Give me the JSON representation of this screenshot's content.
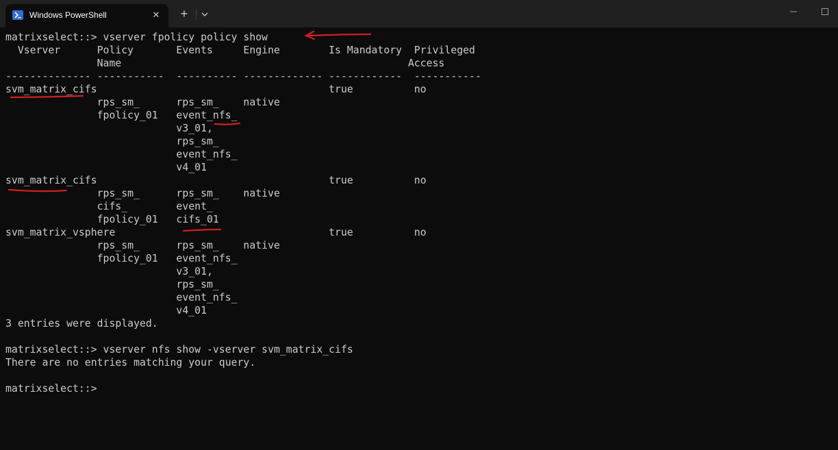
{
  "window": {
    "tab_title": "Windows PowerShell",
    "tab_icon": "powershell-icon",
    "close_tab_icon": "close-icon",
    "new_tab_icon": "plus-icon",
    "dropdown_icon": "chevron-down-icon",
    "minimize_icon": "minimize-icon",
    "maximize_icon": "maximize-icon"
  },
  "terminal": {
    "lines": [
      "matrixselect::> vserver fpolicy policy show",
      "  Vserver      Policy       Events     Engine        Is Mandatory  Privileged",
      "               Name                                               Access",
      "-------------- -----------  ---------- ------------- ------------  -----------",
      "svm_matrix_cifs                                      true          no",
      "               rps_sm_      rps_sm_    native",
      "               fpolicy_01   event_nfs_",
      "                            v3_01,",
      "                            rps_sm_",
      "                            event_nfs_",
      "                            v4_01",
      "svm_matrix_cifs                                      true          no",
      "               rps_sm_      rps_sm_    native",
      "               cifs_        event_",
      "               fpolicy_01   cifs_01",
      "svm_matrix_vsphere                                   true          no",
      "               rps_sm_      rps_sm_    native",
      "               fpolicy_01   event_nfs_",
      "                            v3_01,",
      "                            rps_sm_",
      "                            event_nfs_",
      "                            v4_01",
      "3 entries were displayed.",
      "",
      "matrixselect::> vserver nfs show -vserver svm_matrix_cifs",
      "There are no entries matching your query.",
      "",
      "matrixselect::>"
    ]
  },
  "colors": {
    "background": "#0c0c0c",
    "titlebar": "#202020",
    "text": "#cccccc",
    "annotation": "#d11f1f"
  }
}
